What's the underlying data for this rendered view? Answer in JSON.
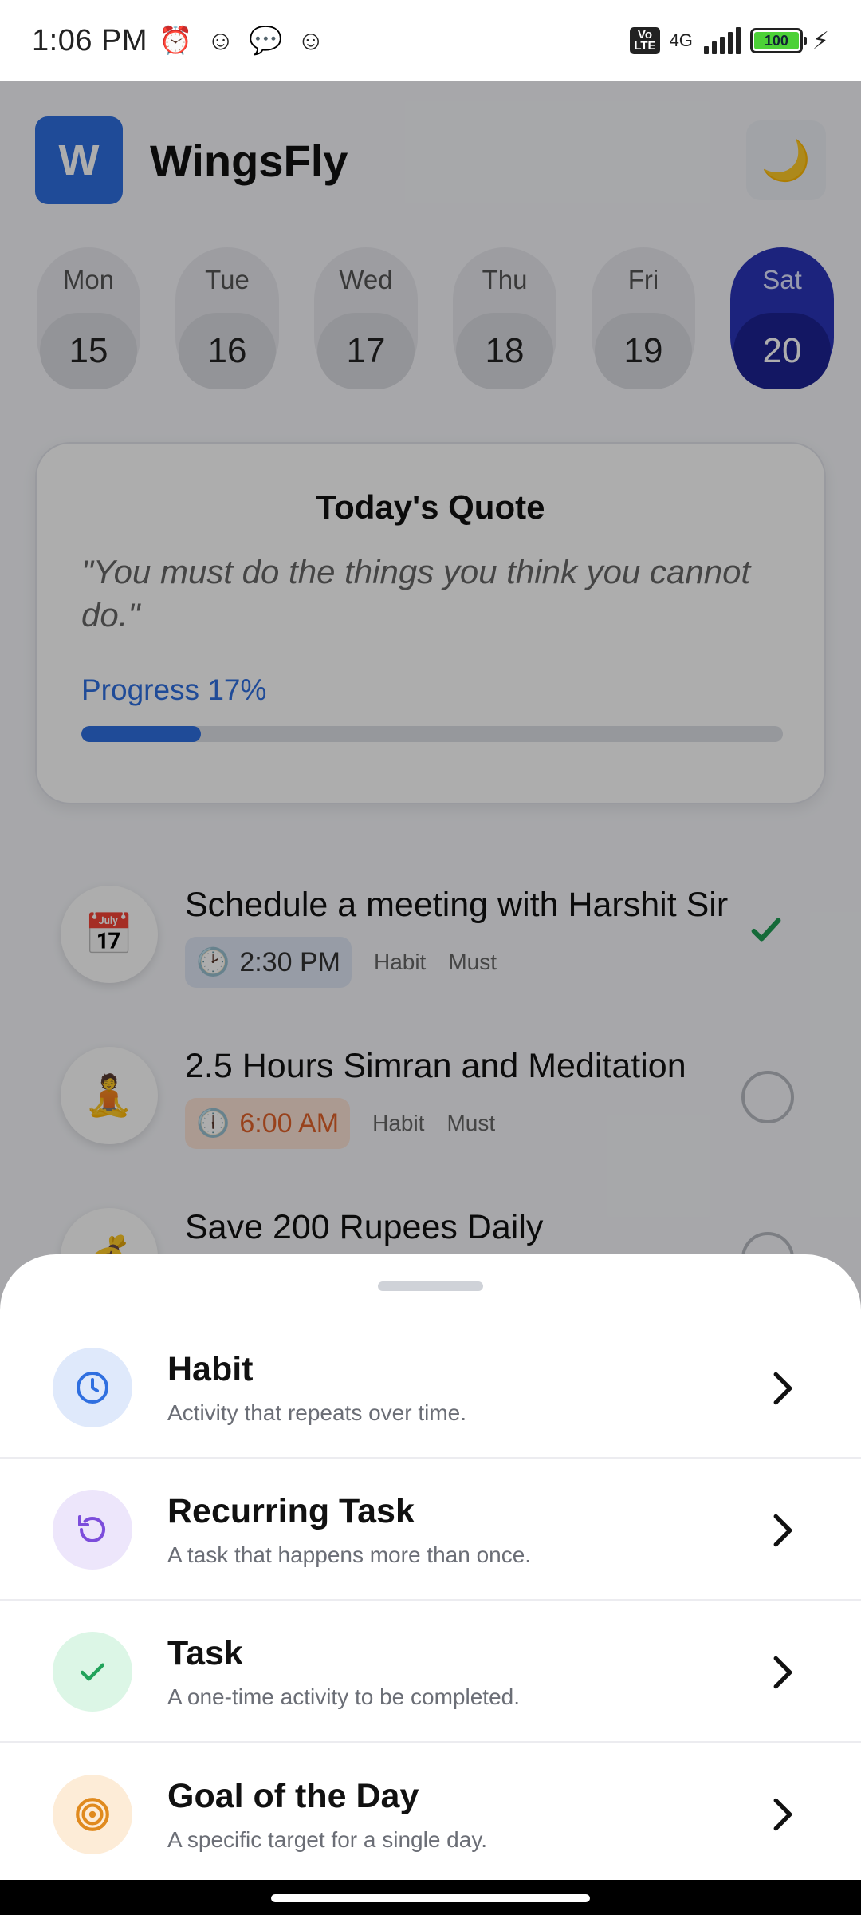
{
  "status_bar": {
    "time": "1:06 PM",
    "volte": "Vo\nLTE",
    "network": "4G",
    "battery": "100"
  },
  "app": {
    "logo_letter": "W",
    "title": "WingsFly",
    "theme_icon": "moon-icon"
  },
  "days": [
    {
      "name": "Mon",
      "num": "15"
    },
    {
      "name": "Tue",
      "num": "16"
    },
    {
      "name": "Wed",
      "num": "17"
    },
    {
      "name": "Thu",
      "num": "18"
    },
    {
      "name": "Fri",
      "num": "19"
    },
    {
      "name": "Sat",
      "num": "20",
      "active": true
    }
  ],
  "quote": {
    "title": "Today's Quote",
    "text": "\"You must do the things you think you cannot do.\"",
    "progress_label": "Progress 17%",
    "progress_value": 0.17
  },
  "tasks": [
    {
      "icon": "calendar-icon",
      "title": "Schedule a meeting with Harshit Sir",
      "time": "2:30 PM",
      "type": "Habit",
      "priority": "Must",
      "done": true
    },
    {
      "icon": "meditation-icon",
      "title": "2.5 Hours Simran and Meditation",
      "time": "6:00 AM",
      "type": "Habit",
      "priority": "Must",
      "done": false
    },
    {
      "icon": "money-bag-icon",
      "title": "Save 200 Rupees Daily",
      "done": false
    }
  ],
  "sheet": {
    "options": [
      {
        "title": "Habit",
        "subtitle": "Activity that repeats over time.",
        "icon": "clock-icon",
        "color": "#2f6fe0",
        "bg": "#dfe9fb"
      },
      {
        "title": "Recurring Task",
        "subtitle": "A task that happens more than once.",
        "icon": "repeat-icon",
        "color": "#7c4ddb",
        "bg": "#ede6fb"
      },
      {
        "title": "Task",
        "subtitle": "A one-time activity to be completed.",
        "icon": "check-icon",
        "color": "#21a35a",
        "bg": "#dcf6e6"
      },
      {
        "title": "Goal of the Day",
        "subtitle": "A specific target for a single day.",
        "icon": "target-icon",
        "color": "#e08a1e",
        "bg": "#fdecd7"
      }
    ]
  }
}
